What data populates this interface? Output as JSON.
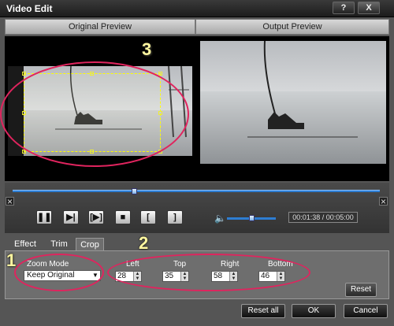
{
  "window": {
    "title": "Video Edit",
    "help_label": "?",
    "close_label": "X"
  },
  "preview": {
    "original_label": "Original Preview",
    "output_label": "Output Preview"
  },
  "annotations": {
    "one": "1",
    "two": "2",
    "three": "3"
  },
  "playback": {
    "buttons": [
      {
        "name": "pause-button",
        "glyph": "❚❚"
      },
      {
        "name": "next-frame-button",
        "glyph": "▶|"
      },
      {
        "name": "clip-button",
        "glyph": "[▶]"
      },
      {
        "name": "stop-button",
        "glyph": "■"
      },
      {
        "name": "mark-in-button",
        "glyph": "["
      },
      {
        "name": "mark-out-button",
        "glyph": "]"
      }
    ],
    "volume_icon": "speaker-icon",
    "time": "00:01:38 / 00:05:00",
    "seek_progress": 0.33,
    "volume_level": 0.5
  },
  "tabs": [
    "Effect",
    "Trim",
    "Crop"
  ],
  "active_tab": "Crop",
  "crop": {
    "zoom_mode_label": "Zoom Mode",
    "zoom_mode_value": "Keep Original",
    "left_label": "Left",
    "left_value": "28",
    "top_label": "Top",
    "top_value": "35",
    "right_label": "Right",
    "right_value": "58",
    "bottom_label": "Bottom",
    "bottom_value": "46",
    "reset_label": "Reset"
  },
  "footer": {
    "reset_all_label": "Reset all",
    "ok_label": "OK",
    "cancel_label": "Cancel"
  },
  "colors": {
    "accent": "#2d7dd2",
    "annotation_ellipse": "#e0245e",
    "annotation_number": "#fff7a0",
    "crop_frame": "#ffff00"
  }
}
